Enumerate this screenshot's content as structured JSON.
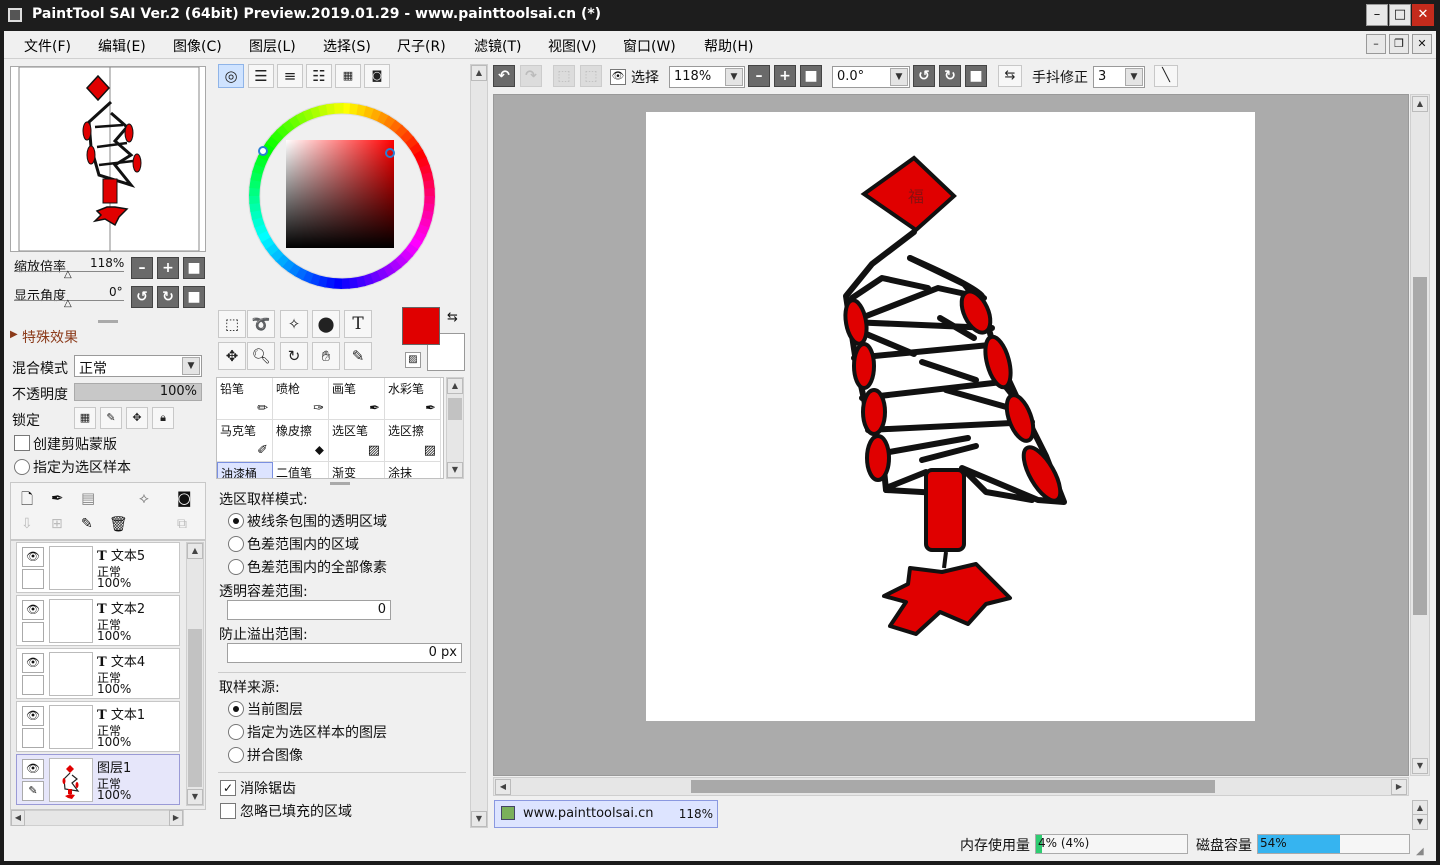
{
  "window": {
    "title": "PaintTool SAI Ver.2 (64bit) Preview.2019.01.29 - www.painttoolsai.cn (*)",
    "btn_min": "–",
    "btn_max": "□",
    "btn_close": "✕"
  },
  "menu": {
    "items": [
      "文件(F)",
      "编辑(E)",
      "图像(C)",
      "图层(L)",
      "选择(S)",
      "尺子(R)",
      "滤镜(T)",
      "视图(V)",
      "窗口(W)",
      "帮助(H)"
    ],
    "mdi_min": "–",
    "mdi_restore": "❐",
    "mdi_close": "✕"
  },
  "navigator": {
    "zoom_label": "缩放倍率",
    "zoom_value": "118%",
    "angle_label": "显示角度",
    "angle_value": "0°"
  },
  "layer_props": {
    "effects_header": "特殊效果",
    "blend_label": "混合模式",
    "blend_value": "正常",
    "opacity_label": "不透明度",
    "opacity_value": "100%",
    "opacity_percent": 100,
    "lock_label": "锁定",
    "clip_label": "创建剪贴蒙版",
    "sample_label": "指定为选区样本"
  },
  "layers": [
    {
      "name": "文本5",
      "mode": "正常",
      "opacity": "100%",
      "type": "text",
      "selected": false
    },
    {
      "name": "文本2",
      "mode": "正常",
      "opacity": "100%",
      "type": "text",
      "selected": false
    },
    {
      "name": "文本4",
      "mode": "正常",
      "opacity": "100%",
      "type": "text",
      "selected": false
    },
    {
      "name": "文本1",
      "mode": "正常",
      "opacity": "100%",
      "type": "text",
      "selected": false
    },
    {
      "name": "图层1",
      "mode": "正常",
      "opacity": "100%",
      "type": "raster",
      "selected": true
    }
  ],
  "colors": {
    "primary": "#e00000",
    "secondary": "#ffffff",
    "canvas_bg": "#ababab",
    "accent": "#c42b1c"
  },
  "brushes": [
    {
      "name": "铅笔",
      "icon": "pencil-icon"
    },
    {
      "name": "喷枪",
      "icon": "airbrush-icon"
    },
    {
      "name": "画笔",
      "icon": "brush-icon"
    },
    {
      "name": "水彩笔",
      "icon": "watercolor-icon"
    },
    {
      "name": "马克笔",
      "icon": "marker-icon"
    },
    {
      "name": "橡皮擦",
      "icon": "eraser-icon"
    },
    {
      "name": "选区笔",
      "icon": "selection-pen-icon"
    },
    {
      "name": "选区擦",
      "icon": "selection-eraser-icon"
    },
    {
      "name": "油漆桶",
      "icon": "bucket-icon"
    },
    {
      "name": "二值笔",
      "icon": "binary-pen-icon"
    },
    {
      "name": "渐变",
      "icon": "gradient-icon"
    },
    {
      "name": "涂抹",
      "icon": "smudge-icon"
    }
  ],
  "tool_options": {
    "mode_label": "选区取样模式:",
    "modes": [
      "被线条包围的透明区域",
      "色差范围内的区域",
      "色差范围内的全部像素"
    ],
    "tolerance_label": "透明容差范围:",
    "tolerance_value": "0",
    "overflow_label": "防止溢出范围:",
    "overflow_value": "0 px",
    "source_label": "取样来源:",
    "sources": [
      "当前图层",
      "指定为选区样本的图层",
      "拼合图像"
    ],
    "antialias_label": "消除锯齿",
    "ignore_label": "忽略已填充的区域"
  },
  "canvas_toolbar": {
    "select_label": "选择",
    "zoom_value": "118%",
    "angle_value": "0.0°",
    "stabilizer_label": "手抖修正",
    "stabilizer_value": "3"
  },
  "canvas": {
    "fu_char": "福"
  },
  "doc_tab": {
    "name": "www.painttoolsai.cn",
    "zoom": "118%"
  },
  "status": {
    "memory_label": "内存使用量",
    "memory_value": "4% (4%)",
    "memory_percent": 4,
    "disk_label": "磁盘容量",
    "disk_value": "54%",
    "disk_percent": 54
  }
}
